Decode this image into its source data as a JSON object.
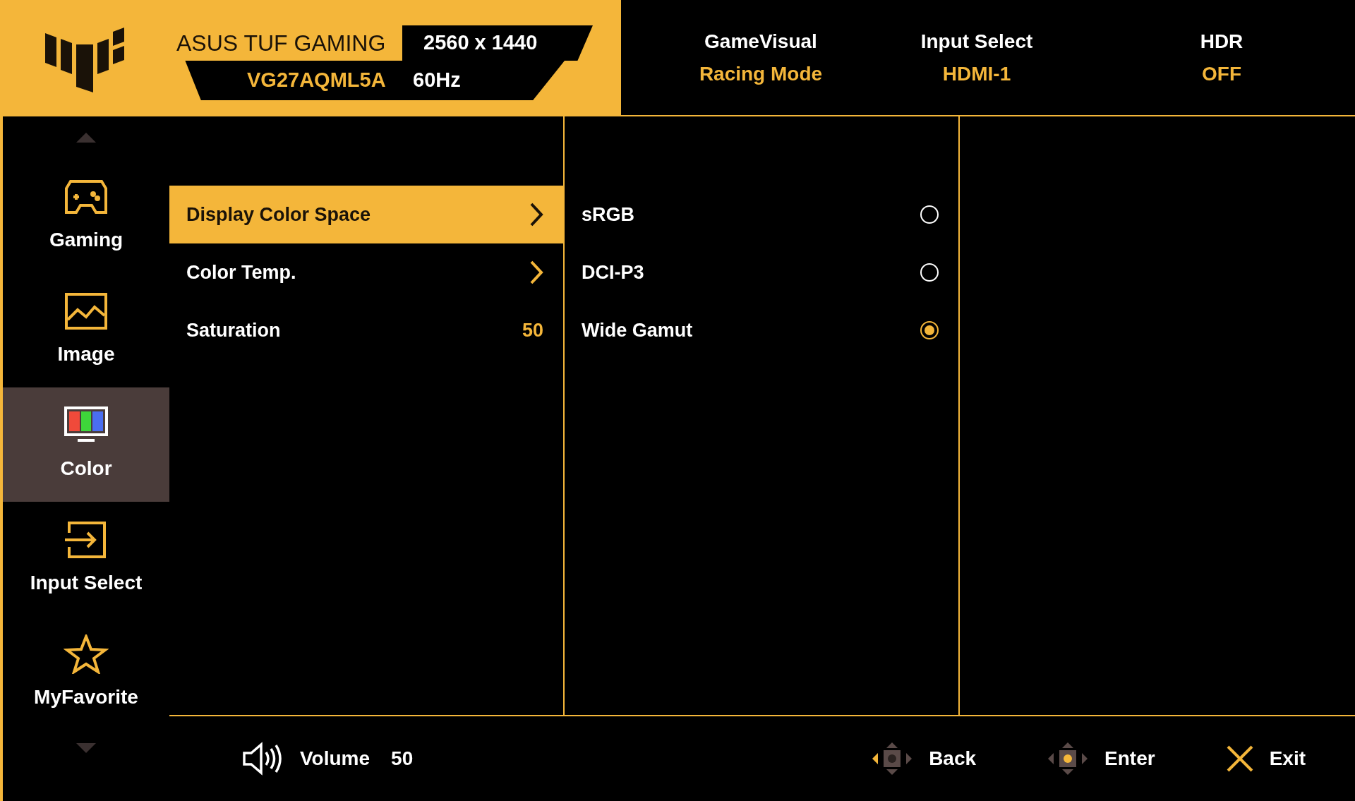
{
  "header": {
    "brand": "ASUS TUF GAMING",
    "model": "VG27AQML5A",
    "resolution": "2560 x 1440",
    "refresh": "60Hz",
    "status": [
      {
        "label": "GameVisual",
        "value": "Racing Mode"
      },
      {
        "label": "Input Select",
        "value": "HDMI-1"
      },
      {
        "label": "HDR",
        "value": "OFF"
      }
    ]
  },
  "sidebar": {
    "items": [
      {
        "label": "Gaming",
        "selected": false
      },
      {
        "label": "Image",
        "selected": false
      },
      {
        "label": "Color",
        "selected": true
      },
      {
        "label": "Input Select",
        "selected": false
      },
      {
        "label": "MyFavorite",
        "selected": false
      }
    ]
  },
  "menu": {
    "items": [
      {
        "kind": "submenu",
        "label": "Display Color Space",
        "selected": true
      },
      {
        "kind": "submenu",
        "label": "Color Temp.",
        "selected": false
      },
      {
        "kind": "value",
        "label": "Saturation",
        "value": "50",
        "selected": false
      }
    ]
  },
  "options": [
    {
      "label": "sRGB",
      "selected": false
    },
    {
      "label": "DCI-P3",
      "selected": false
    },
    {
      "label": "Wide Gamut",
      "selected": true
    }
  ],
  "footer": {
    "volume": {
      "label": "Volume",
      "value": "50"
    },
    "actions": [
      {
        "kind": "back",
        "label": "Back"
      },
      {
        "kind": "enter",
        "label": "Enter"
      },
      {
        "kind": "exit",
        "label": "Exit"
      }
    ]
  }
}
